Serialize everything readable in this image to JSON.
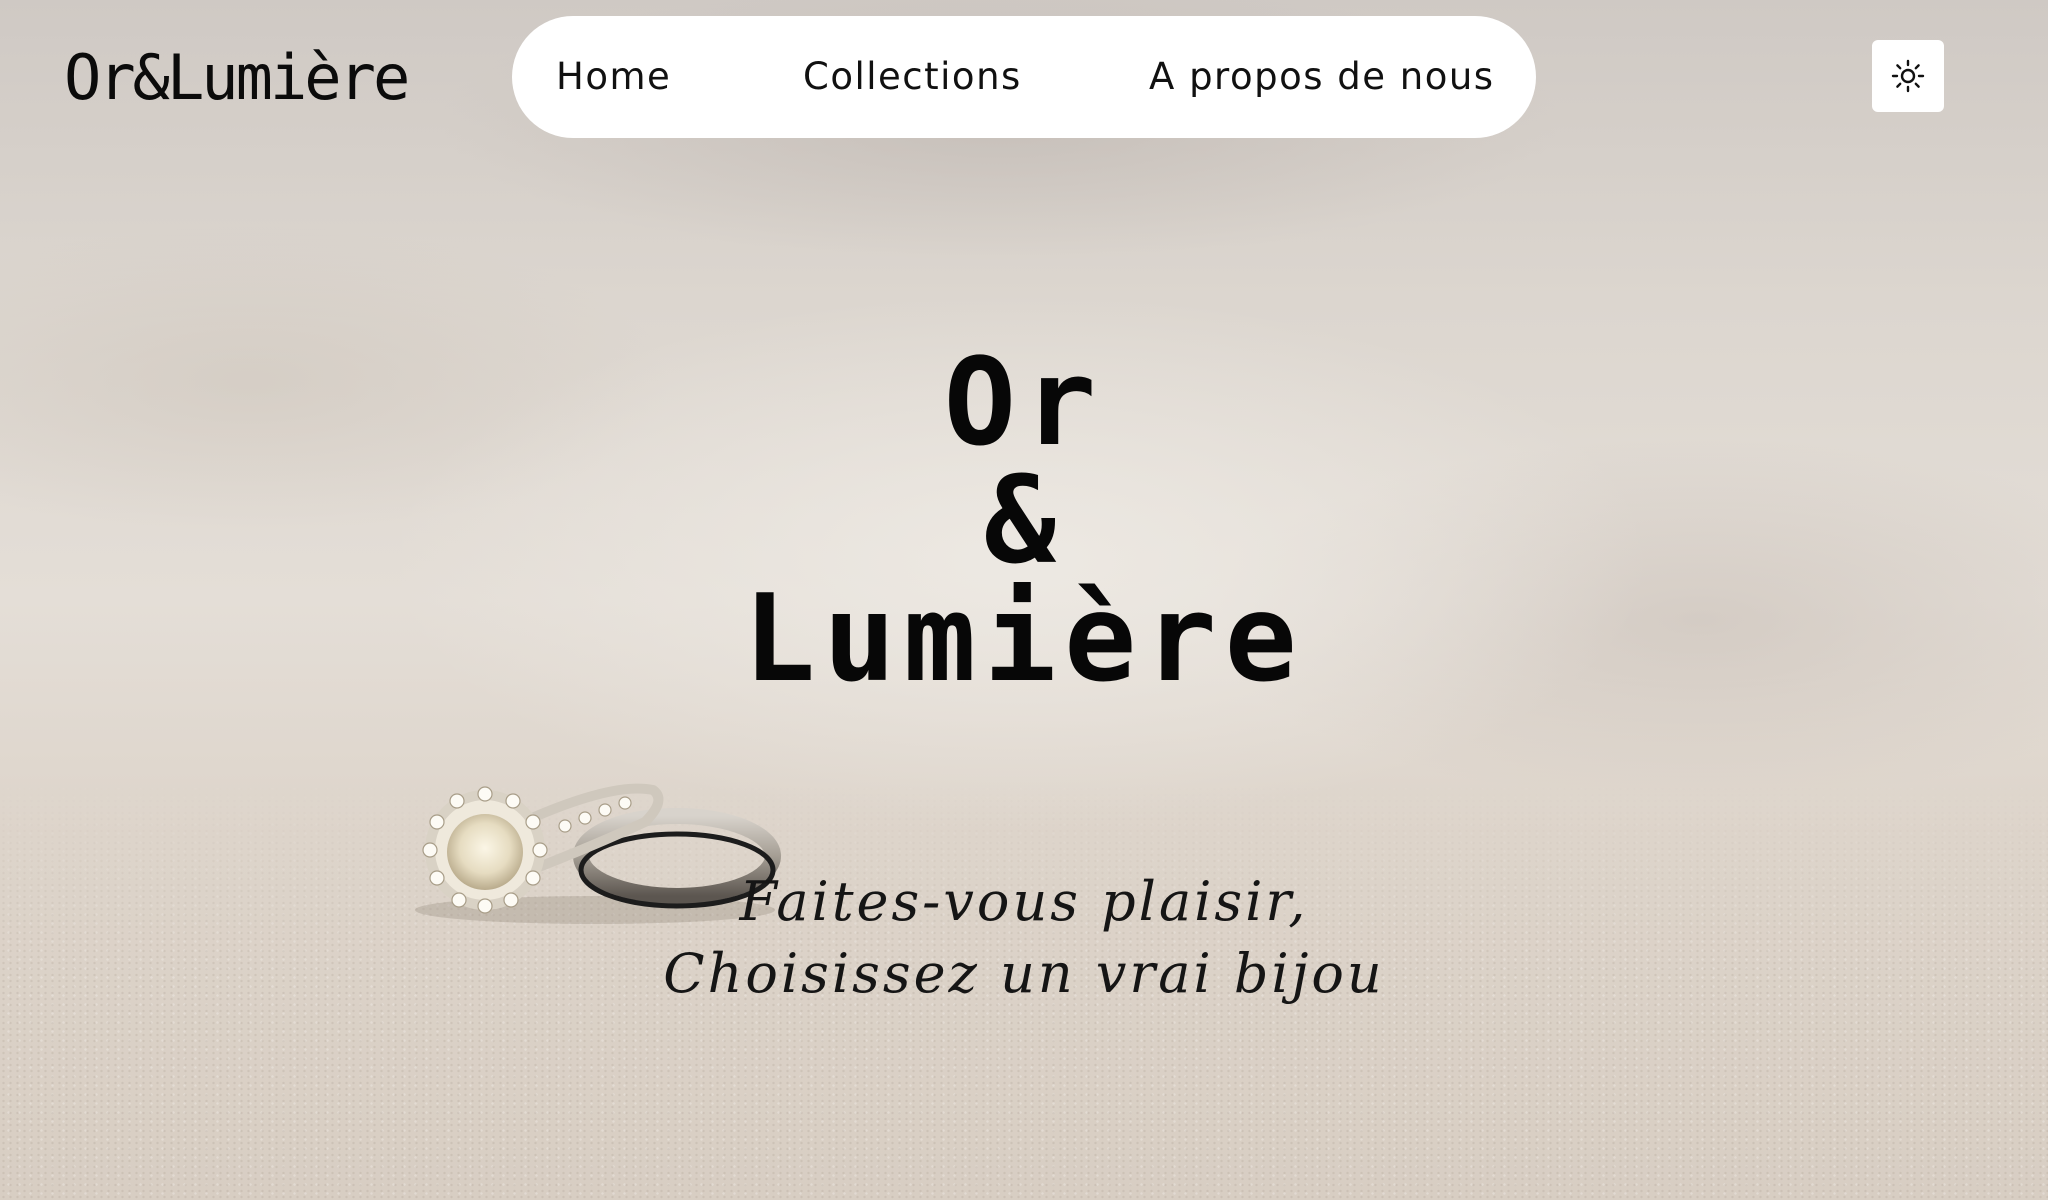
{
  "header": {
    "logo": "Or&Lumière",
    "nav": [
      {
        "label": "Home"
      },
      {
        "label": "Collections"
      },
      {
        "label": "A propos de nous"
      }
    ],
    "theme_toggle_icon": "sun-icon"
  },
  "hero": {
    "title_lines": [
      "Or",
      "&",
      "Lumière"
    ],
    "tagline_lines": [
      "Faites-vous plaisir,",
      "Choisissez un vrai bijou"
    ],
    "image": "rings-on-sand"
  },
  "colors": {
    "text": "#0b0b0b",
    "nav_bg": "#ffffff",
    "background": "#ddd6ce"
  }
}
